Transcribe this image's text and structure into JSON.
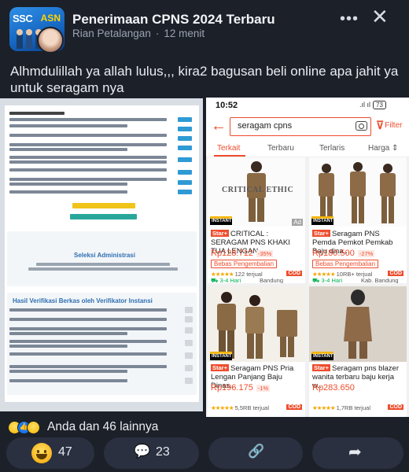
{
  "post": {
    "group_name": "Penerimaan CPNS 2024 Terbaru",
    "author": "Rian Petalangan",
    "time_ago": "12 menit",
    "separator": "·",
    "more_icon": "•••",
    "close_icon": "✕",
    "text": "Alhmdulillah ya allah lulus,,, kira2 bagusan beli online apa jahit ya untuk seragam nya",
    "group_avatar": {
      "left_text": "SSC",
      "right_text": "ASN"
    }
  },
  "doc_screenshot": {
    "heading1": "Seleksi Administrasi",
    "heading2": "Hasil Verifikasi Berkas oleh Verifikator Instansi"
  },
  "shop": {
    "status_time": "10:52",
    "status_right": ".ıl ıl",
    "battery": "73",
    "search_value": "seragam cpns",
    "filter_label": "Filter",
    "tabs": [
      "Terkait",
      "Terbaru",
      "Terlaris",
      "Harga"
    ],
    "harga_arrow": "⇕",
    "ad_label": "Ad",
    "products": [
      {
        "star_label": "Star+",
        "title": "CRITICAL : SERAGAM PNS KHAKI TUA LENGAN ...",
        "price": "Rp128.712",
        "discount": "-35%",
        "chip": "Bebas Pengembalian",
        "rating": "★★★★★",
        "sold": "122 terjual",
        "ship": "3-4 Hari",
        "location": "Bandung",
        "cod": "COD",
        "watermark": "CRITICAL ETHIC"
      },
      {
        "star_label": "Star+",
        "title": "Seragam PNS Pemda Pemkot Pemkab Baju dina...",
        "price": "Rp180.500",
        "discount": "-27%",
        "chip": "Bebas Pengembalian",
        "rating": "★★★★★",
        "sold": "10RB+ terjual",
        "ship": "3-4 Hari",
        "location": "Kab. Bandung",
        "cod": "COD"
      },
      {
        "star_label": "Star+",
        "title": "Seragam PNS Pria Lengan Panjang Baju Dinas...",
        "price": "Rp196.175",
        "discount": "-1%",
        "rating": "★★★★★",
        "sold": "5,5RB terjual",
        "cod": "COD"
      },
      {
        "star_label": "Star+",
        "title": "Seragam pns blazer wanita terbaru baju kerja w...",
        "price": "Rp283.650",
        "rating": "★★★★★",
        "sold": "1,7RB terjual",
        "cod": "COD"
      }
    ]
  },
  "reactions": {
    "summary": "Anda dan 46 lainnya"
  },
  "actions": {
    "react_count": "47",
    "comment_icon": "💬",
    "comment_count": "23",
    "link_icon": "🔗",
    "share_icon": "➦"
  },
  "colors": {
    "background": "#1c2029",
    "accent_shop": "#ee4d2d",
    "button_bg": "#2b3040"
  }
}
